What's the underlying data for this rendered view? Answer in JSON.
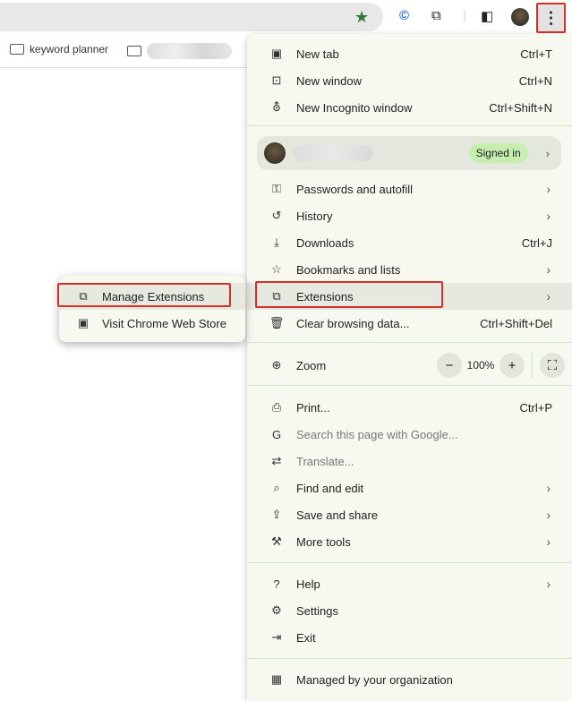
{
  "toolbar": {
    "bookmark_star": "★",
    "menu_icon": "⋮"
  },
  "bookmarks_bar": {
    "items": [
      {
        "label": "keyword planner"
      }
    ]
  },
  "menu": {
    "group1": [
      {
        "icon": "new-tab-icon",
        "glyph": "▣",
        "label": "New tab",
        "shortcut": "Ctrl+T"
      },
      {
        "icon": "new-window-icon",
        "glyph": "⊡",
        "label": "New window",
        "shortcut": "Ctrl+N"
      },
      {
        "icon": "incognito-icon",
        "glyph": "⛢",
        "label": "New Incognito window",
        "shortcut": "Ctrl+Shift+N"
      }
    ],
    "profile": {
      "status": "Signed in"
    },
    "group2": [
      {
        "icon": "key-icon",
        "glyph": "⚿",
        "label": "Passwords and autofill",
        "chevron": true
      },
      {
        "icon": "history-icon",
        "glyph": "↺",
        "label": "History",
        "chevron": true
      },
      {
        "icon": "download-icon",
        "glyph": "⤓",
        "label": "Downloads",
        "shortcut": "Ctrl+J"
      },
      {
        "icon": "star-icon",
        "glyph": "☆",
        "label": "Bookmarks and lists",
        "chevron": true
      },
      {
        "icon": "extension-icon",
        "glyph": "⧉",
        "label": "Extensions",
        "chevron": true
      },
      {
        "icon": "trash-icon",
        "glyph": "🗑",
        "label": "Clear browsing data...",
        "shortcut": "Ctrl+Shift+Del"
      }
    ],
    "zoom": {
      "label": "Zoom",
      "value": "100%",
      "minus": "−",
      "plus": "+",
      "fullscreen": "⛶"
    },
    "group3": [
      {
        "icon": "print-icon",
        "glyph": "⎙",
        "label": "Print...",
        "shortcut": "Ctrl+P"
      },
      {
        "icon": "google-icon",
        "glyph": "G",
        "label": "Search this page with Google...",
        "disabled": true
      },
      {
        "icon": "translate-icon",
        "glyph": "⇄",
        "label": "Translate...",
        "disabled": true
      },
      {
        "icon": "find-icon",
        "glyph": "⌕",
        "label": "Find and edit",
        "chevron": true
      },
      {
        "icon": "save-share-icon",
        "glyph": "⇪",
        "label": "Save and share",
        "chevron": true
      },
      {
        "icon": "toolbox-icon",
        "glyph": "⚒",
        "label": "More tools",
        "chevron": true
      }
    ],
    "group4": [
      {
        "icon": "help-icon",
        "glyph": "?",
        "label": "Help",
        "chevron": true
      },
      {
        "icon": "settings-icon",
        "glyph": "⚙",
        "label": "Settings"
      },
      {
        "icon": "exit-icon",
        "glyph": "⇥",
        "label": "Exit"
      }
    ],
    "managed": {
      "icon": "building-icon",
      "glyph": "▦",
      "label": "Managed by your organization"
    }
  },
  "submenu": {
    "items": [
      {
        "label": "Manage Extensions",
        "glyph": "⧉"
      },
      {
        "label": "Visit Chrome Web Store",
        "glyph": "▣"
      }
    ]
  }
}
